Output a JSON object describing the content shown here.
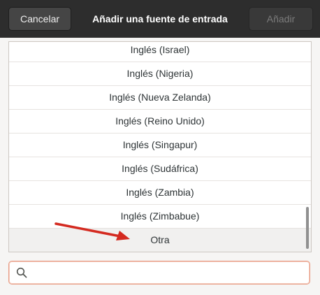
{
  "header": {
    "cancel_label": "Cancelar",
    "title": "Añadir una fuente de entrada",
    "add_label": "Añadir"
  },
  "list": {
    "items": [
      {
        "label": "Inglés (Israel)"
      },
      {
        "label": "Inglés (Nigeria)"
      },
      {
        "label": "Inglés (Nueva Zelanda)"
      },
      {
        "label": "Inglés (Reino Unido)"
      },
      {
        "label": "Inglés (Singapur)"
      },
      {
        "label": "Inglés (Sudáfrica)"
      },
      {
        "label": "Inglés (Zambia)"
      },
      {
        "label": "Inglés (Zimbabue)"
      },
      {
        "label": "Otra"
      }
    ]
  },
  "search": {
    "value": "",
    "placeholder": ""
  },
  "colors": {
    "header_bg": "#2d2d2d",
    "annotation_arrow": "#d42a20",
    "search_focus_border": "#e89a82"
  },
  "icons": {
    "search": "search-icon",
    "annotation": "red-arrow-icon"
  }
}
